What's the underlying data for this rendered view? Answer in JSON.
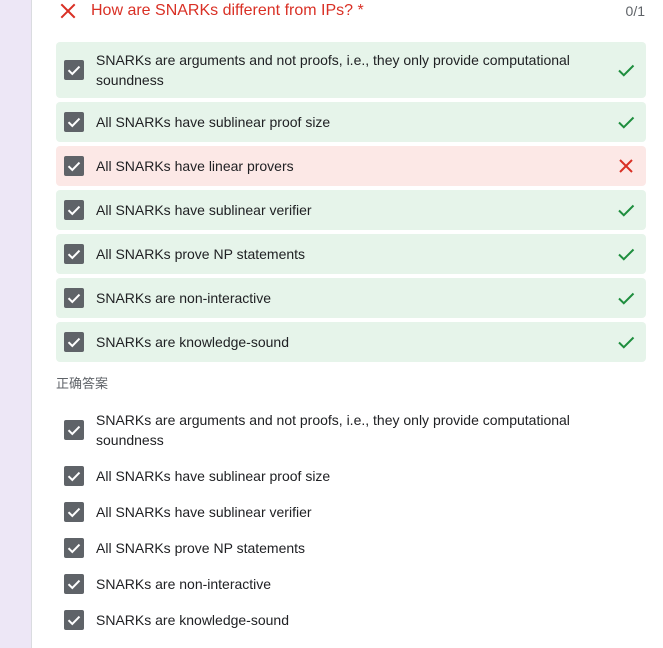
{
  "question": {
    "title": "How are SNARKs different from IPs? *",
    "score": "0/1",
    "status_icon": "close-icon"
  },
  "options": [
    {
      "label": "SNARKs are arguments and not proofs, i.e., they only provide computational soundness",
      "checked": true,
      "result": "correct"
    },
    {
      "label": "All SNARKs have sublinear proof size",
      "checked": true,
      "result": "correct"
    },
    {
      "label": "All SNARKs have linear provers",
      "checked": true,
      "result": "wrong"
    },
    {
      "label": "All SNARKs have sublinear verifier",
      "checked": true,
      "result": "correct"
    },
    {
      "label": "All SNARKs prove NP statements",
      "checked": true,
      "result": "correct"
    },
    {
      "label": "SNARKs are non-interactive",
      "checked": true,
      "result": "correct"
    },
    {
      "label": "SNARKs are knowledge-sound",
      "checked": true,
      "result": "correct"
    }
  ],
  "correct_answers": {
    "heading": "正确答案",
    "items": [
      "SNARKs are arguments and not proofs, i.e., they only provide computational soundness",
      "All SNARKs have sublinear proof size",
      "All SNARKs have sublinear verifier",
      "All SNARKs prove NP statements",
      "SNARKs are non-interactive",
      "SNARKs are knowledge-sound"
    ]
  },
  "colors": {
    "correct_bg": "#e6f4ea",
    "wrong_bg": "#fce8e6",
    "correct_mark": "#1e8e3e",
    "wrong_mark": "#d93025",
    "checkbox": "#5f6368"
  }
}
